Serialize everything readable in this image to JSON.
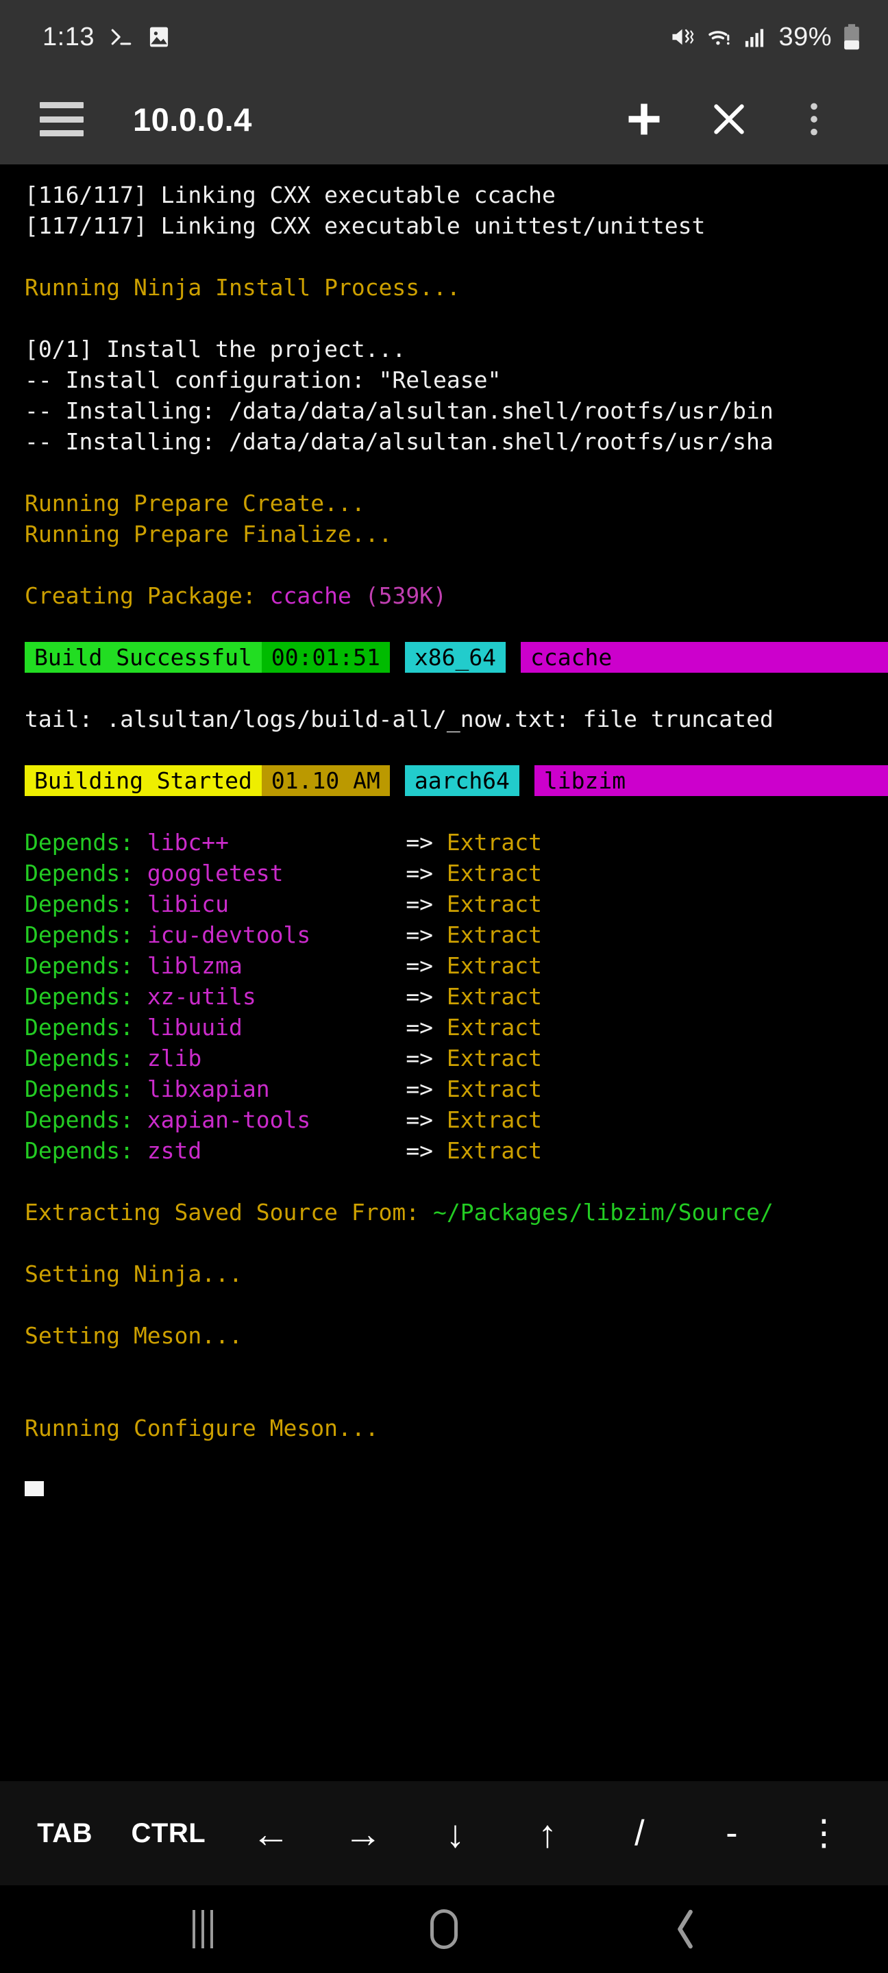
{
  "status_bar": {
    "time": "1:13",
    "battery_percent": "39%",
    "icons": [
      "terminal-icon",
      "gallery-icon",
      "mute-vibrate-icon",
      "wifi-warning-icon",
      "cellular-signal-icon",
      "battery-icon"
    ]
  },
  "app_bar": {
    "title": "10.0.0.4",
    "menu_label": "menu",
    "new_session_label": "+",
    "close_label": "×",
    "more_label": "more options"
  },
  "terminal": {
    "lines": [
      {
        "type": "text",
        "spans": [
          {
            "text": "[116/117] Linking CXX executable ccache",
            "color": "white"
          }
        ]
      },
      {
        "type": "text",
        "spans": [
          {
            "text": "[117/117] Linking CXX executable unittest/unittest",
            "color": "white"
          }
        ]
      },
      {
        "type": "blank"
      },
      {
        "type": "text",
        "spans": [
          {
            "text": "Running Ninja Install Process...",
            "color": "olive"
          }
        ]
      },
      {
        "type": "blank"
      },
      {
        "type": "text",
        "spans": [
          {
            "text": "[0/1] Install the project...",
            "color": "white"
          }
        ]
      },
      {
        "type": "text",
        "spans": [
          {
            "text": "-- Install configuration: \"Release\"",
            "color": "white"
          }
        ]
      },
      {
        "type": "text",
        "spans": [
          {
            "text": "-- Installing: /data/data/alsultan.shell/rootfs/usr/bin",
            "color": "white"
          }
        ]
      },
      {
        "type": "text",
        "spans": [
          {
            "text": "-- Installing: /data/data/alsultan.shell/rootfs/usr/sha",
            "color": "white"
          }
        ]
      },
      {
        "type": "blank"
      },
      {
        "type": "text",
        "spans": [
          {
            "text": "Running Prepare Create...",
            "color": "olive"
          }
        ]
      },
      {
        "type": "text",
        "spans": [
          {
            "text": "Running Prepare Finalize...",
            "color": "olive"
          }
        ]
      },
      {
        "type": "blank"
      },
      {
        "type": "text",
        "spans": [
          {
            "text": "Creating Package: ",
            "color": "olive"
          },
          {
            "text": "ccache",
            "color": "magenta"
          },
          {
            "text": " (539K)",
            "color": "magenta2"
          }
        ]
      },
      {
        "type": "blank"
      },
      {
        "type": "badges",
        "badges": [
          {
            "text": "Build Successful",
            "bg": "green-bright"
          },
          {
            "text": "00:01:51",
            "bg": "green-dark"
          },
          {
            "gap": true
          },
          {
            "text": "x86_64",
            "bg": "cyan"
          },
          {
            "gap": true
          },
          {
            "text": "ccache",
            "bg": "magenta",
            "flex": true
          }
        ]
      },
      {
        "type": "blank"
      },
      {
        "type": "text",
        "spans": [
          {
            "text": "tail: .alsultan/logs/build-all/_now.txt: file truncated",
            "color": "white"
          }
        ]
      },
      {
        "type": "blank"
      },
      {
        "type": "badges",
        "badges": [
          {
            "text": "Building Started",
            "bg": "yellow-bright"
          },
          {
            "text": "01.10 AM",
            "bg": "yellow-dark"
          },
          {
            "gap": true
          },
          {
            "text": "aarch64",
            "bg": "cyan"
          },
          {
            "gap": true
          },
          {
            "text": "libzim",
            "bg": "magenta",
            "flex": true
          }
        ]
      },
      {
        "type": "blank"
      },
      {
        "type": "depends",
        "label": "Depends: ",
        "package": "libc++",
        "arrow": "=> ",
        "action": "Extract"
      },
      {
        "type": "depends",
        "label": "Depends: ",
        "package": "googletest",
        "arrow": "=> ",
        "action": "Extract"
      },
      {
        "type": "depends",
        "label": "Depends: ",
        "package": "libicu",
        "arrow": "=> ",
        "action": "Extract"
      },
      {
        "type": "depends",
        "label": "Depends: ",
        "package": "icu-devtools",
        "arrow": "=> ",
        "action": "Extract"
      },
      {
        "type": "depends",
        "label": "Depends: ",
        "package": "liblzma",
        "arrow": "=> ",
        "action": "Extract"
      },
      {
        "type": "depends",
        "label": "Depends: ",
        "package": "xz-utils",
        "arrow": "=> ",
        "action": "Extract"
      },
      {
        "type": "depends",
        "label": "Depends: ",
        "package": "libuuid",
        "arrow": "=> ",
        "action": "Extract"
      },
      {
        "type": "depends",
        "label": "Depends: ",
        "package": "zlib",
        "arrow": "=> ",
        "action": "Extract"
      },
      {
        "type": "depends",
        "label": "Depends: ",
        "package": "libxapian",
        "arrow": "=> ",
        "action": "Extract"
      },
      {
        "type": "depends",
        "label": "Depends: ",
        "package": "xapian-tools",
        "arrow": "=> ",
        "action": "Extract"
      },
      {
        "type": "depends",
        "label": "Depends: ",
        "package": "zstd",
        "arrow": "=> ",
        "action": "Extract"
      },
      {
        "type": "blank"
      },
      {
        "type": "text",
        "spans": [
          {
            "text": "Extracting Saved Source From: ",
            "color": "olive"
          },
          {
            "text": "~/Packages/libzim/Source/",
            "color": "green"
          }
        ]
      },
      {
        "type": "blank"
      },
      {
        "type": "text",
        "spans": [
          {
            "text": "Setting Ninja...",
            "color": "olive"
          }
        ]
      },
      {
        "type": "blank"
      },
      {
        "type": "text",
        "spans": [
          {
            "text": "Setting Meson...",
            "color": "olive"
          }
        ]
      },
      {
        "type": "blank"
      },
      {
        "type": "blank"
      },
      {
        "type": "text",
        "spans": [
          {
            "text": "Running Configure Meson...",
            "color": "olive"
          }
        ]
      },
      {
        "type": "blank"
      },
      {
        "type": "cursor"
      }
    ]
  },
  "extra_keys": [
    {
      "label": "TAB",
      "name": "tab-key",
      "style": "word"
    },
    {
      "label": "CTRL",
      "name": "ctrl-key",
      "style": "word"
    },
    {
      "label": "←",
      "name": "arrow-left-key",
      "style": "arrow"
    },
    {
      "label": "→",
      "name": "arrow-right-key",
      "style": "arrow"
    },
    {
      "label": "↓",
      "name": "arrow-down-key",
      "style": "arrow"
    },
    {
      "label": "↑",
      "name": "arrow-up-key",
      "style": "arrow"
    },
    {
      "label": "/",
      "name": "slash-key",
      "style": "sym"
    },
    {
      "label": "-",
      "name": "dash-key",
      "style": "sym"
    },
    {
      "label": "⋮",
      "name": "more-keys-button",
      "style": "sym"
    }
  ],
  "nav_bar": {
    "recents_label": "recents",
    "home_label": "home",
    "back_label": "back"
  },
  "colors": {
    "status_bg": "#333333",
    "terminal_bg": "#000000",
    "white": "#f0f0f0",
    "olive": "#cda000",
    "green": "#23cc23",
    "magenta": "#cb2bcb",
    "badge_green_bright": "#22dd22",
    "badge_green_dark": "#00bb00",
    "badge_yellow_bright": "#eeee00",
    "badge_yellow_dark": "#bb9900",
    "badge_cyan": "#22cccc",
    "badge_magenta": "#cc00cc"
  }
}
